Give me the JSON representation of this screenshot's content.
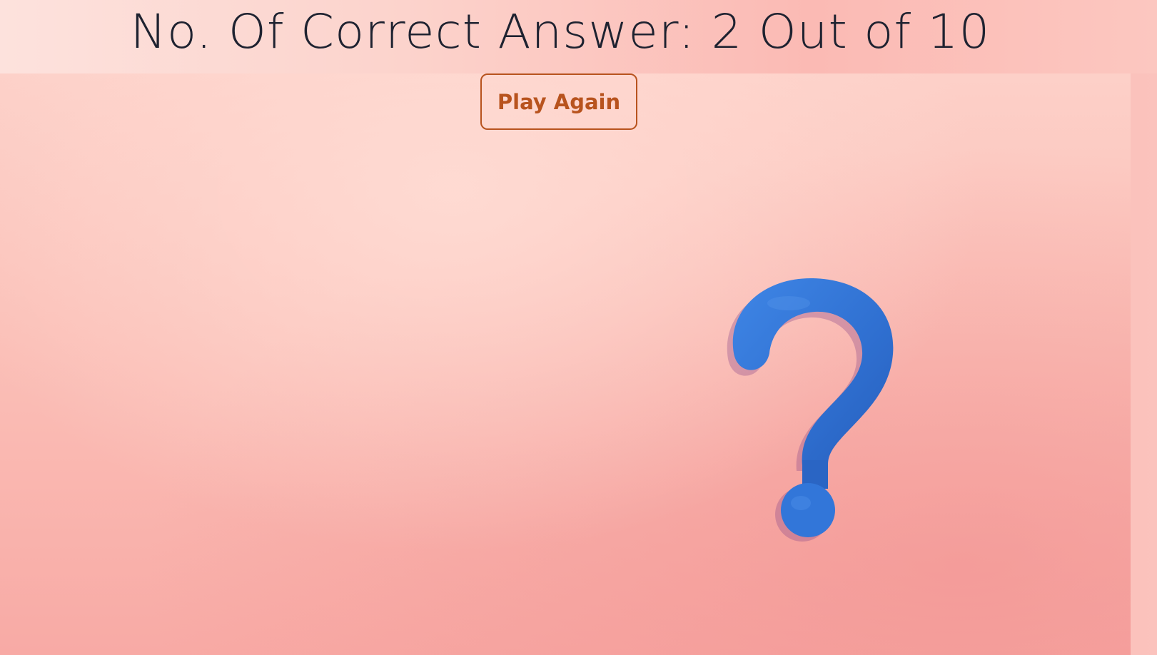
{
  "result": {
    "score_text": "No. Of Correct Answer: 2 Out of 10"
  },
  "actions": {
    "play_again_label": "Play Again"
  },
  "background": {
    "image": "pink-background-with-blue-question-mark",
    "icon": "question-mark-icon",
    "accent_color": "#2f6fd0",
    "button_color": "#b8531e"
  }
}
